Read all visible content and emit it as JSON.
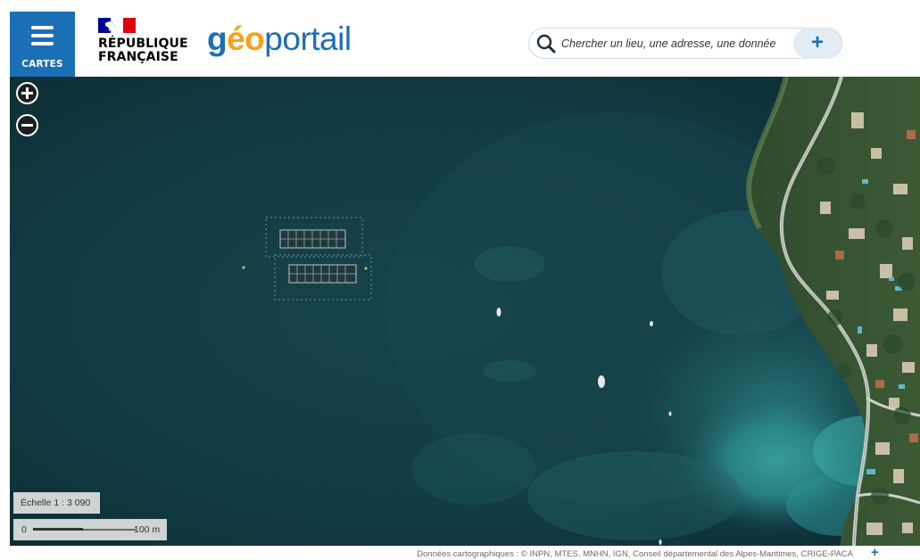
{
  "header": {
    "menu_label": "CARTES",
    "rf_line1": "RÉPUBLIQUE",
    "rf_line2": "FRANÇAISE",
    "logo_part1": "g",
    "logo_part2": "éo",
    "logo_part3": "portail"
  },
  "search": {
    "placeholder": "Chercher un lieu, une adresse, une donnée",
    "add_label": "+"
  },
  "map": {
    "zoom_in": "+",
    "zoom_out": "−",
    "scale_label": "Échelle 1 : 3 090",
    "scale_bar_start": "0",
    "scale_bar_end": "100 m"
  },
  "attribution": {
    "text": "Données cartographiques : ©   INPN,  MTES,  MNHN,  IGN,  Conseil départemental des Alpes-Maritimes,  CRIGE-PACA",
    "more": "+"
  },
  "colors": {
    "brand_blue": "#1b6fb5",
    "logo_orange": "#f7a11a",
    "sea_deep": "#0f3038"
  },
  "icons": {
    "menu": "hamburger-icon",
    "search": "magnifier-icon",
    "add": "plus-icon"
  }
}
